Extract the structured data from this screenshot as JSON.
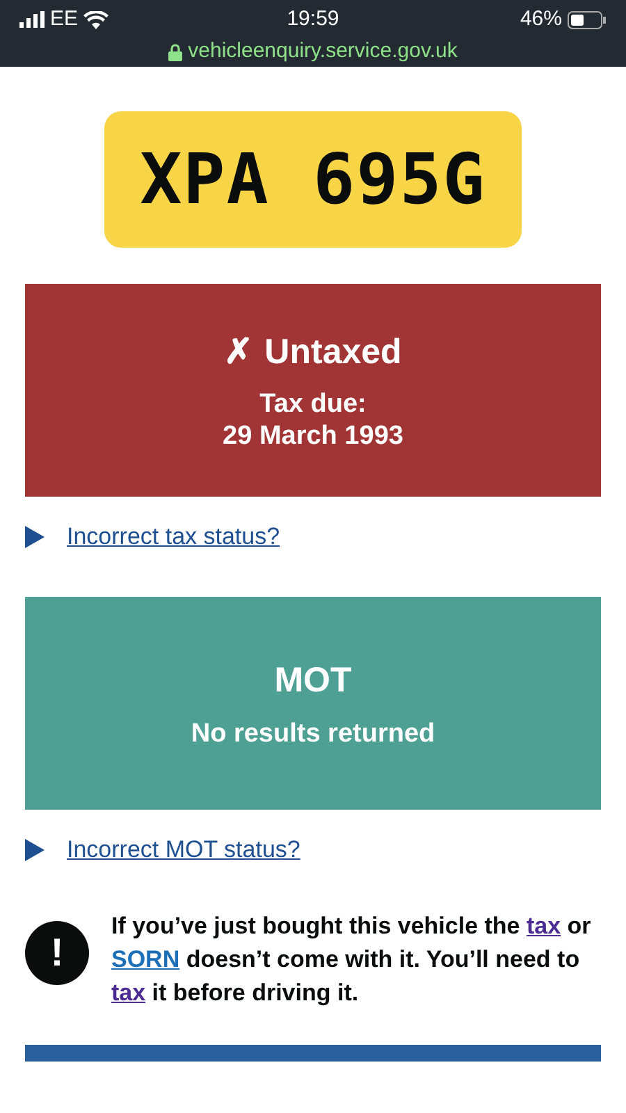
{
  "status_bar": {
    "carrier": "EE",
    "time": "19:59",
    "battery": "46%",
    "url": "vehicleenquiry.service.gov.uk"
  },
  "plate": "XPA 695G",
  "tax_panel": {
    "kind": "untaxed",
    "icon": "✗",
    "title": "Untaxed",
    "label": "Tax due:",
    "date": "29 March 1993"
  },
  "tax_link": "Incorrect tax status?",
  "mot_panel": {
    "kind": "mot",
    "title": "MOT",
    "text": "No results returned"
  },
  "mot_link": "Incorrect MOT status?",
  "warning": {
    "icon": "!",
    "parts": [
      {
        "text": "If you’ve just bought this vehicle the "
      },
      {
        "text": "tax",
        "kind": "link",
        "visited": true
      },
      {
        "text": " or "
      },
      {
        "text": "SORN",
        "kind": "link",
        "visited": false
      },
      {
        "text": " doesn’t come with it. You’ll need to "
      },
      {
        "text": "tax",
        "kind": "link",
        "visited": true
      },
      {
        "text": " it before driving it."
      }
    ]
  }
}
